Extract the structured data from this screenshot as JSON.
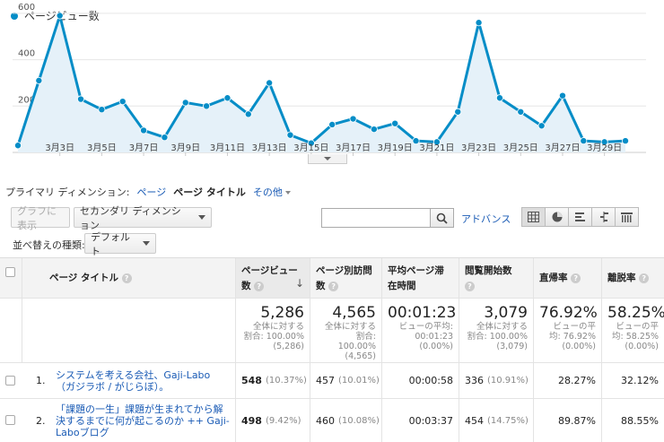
{
  "chart": {
    "legend": "ページビュー数",
    "color": "#058dc7"
  },
  "chart_data": {
    "type": "area",
    "series": [
      {
        "name": "ページビュー数",
        "values": [
          30,
          310,
          590,
          230,
          185,
          220,
          95,
          65,
          215,
          200,
          235,
          165,
          300,
          75,
          40,
          120,
          145,
          100,
          125,
          50,
          45,
          175,
          560,
          235,
          175,
          115,
          245,
          50,
          45,
          50
        ]
      }
    ],
    "x": [
      "3月1日",
      "3月2日",
      "3月3日",
      "3月4日",
      "3月5日",
      "3月6日",
      "3月7日",
      "3月8日",
      "3月9日",
      "3月10日",
      "3月11日",
      "3月12日",
      "3月13日",
      "3月14日",
      "3月15日",
      "3月16日",
      "3月17日",
      "3月18日",
      "3月19日",
      "3月20日",
      "3月21日",
      "3月22日",
      "3月23日",
      "3月24日",
      "3月25日",
      "3月26日",
      "3月27日",
      "3月28日",
      "3月29日",
      "3月30日"
    ],
    "x_tick_labels": [
      "3月3日",
      "3月5日",
      "3月7日",
      "3月9日",
      "3月11日",
      "3月13日",
      "3月15日",
      "3月17日",
      "3月19日",
      "3月21日",
      "3月23日",
      "3月25日",
      "3月27日",
      "3月29日"
    ],
    "y_tick_labels": [
      "200",
      "400",
      "600"
    ],
    "ylim": [
      0,
      650
    ],
    "grid": true
  },
  "dimension": {
    "label": "プライマリ ディメンション:",
    "options": [
      "ページ",
      "ページ タイトル",
      "その他"
    ]
  },
  "toolbar": {
    "graph_button": "グラフに表示",
    "secondary_dimension": "セカンダリ ディメンション",
    "search_value": "",
    "advanced": "アドバンス",
    "sort_label": "並べ替えの種類:",
    "sort_value": "デフォルト"
  },
  "table": {
    "headers": {
      "title": "ページ タイトル",
      "pageviews": "ページビュー数",
      "unique": "ページ別訪問数",
      "avg_time": "平均ページ滞在時間",
      "entrances": "閲覧開始数",
      "bounce": "直帰率",
      "exit": "離脱率"
    },
    "totals": {
      "pageviews": {
        "value": "5,286",
        "sub1": "全体に対する",
        "sub2": "割合: 100.00%",
        "sub3": "(5,286)"
      },
      "unique": {
        "value": "4,565",
        "sub1": "全体に対する",
        "sub2": "割合: 100.00%",
        "sub3": "(4,565)"
      },
      "avg_time": {
        "value": "00:01:23",
        "sub1": "ビューの平均:",
        "sub2": "00:01:23",
        "sub3": "(0.00%)"
      },
      "entrances": {
        "value": "3,079",
        "sub1": "全体に対する",
        "sub2": "割合: 100.00%",
        "sub3": "(3,079)"
      },
      "bounce": {
        "value": "76.92%",
        "sub1": "ビューの平",
        "sub2": "均: 76.92%",
        "sub3": "(0.00%)"
      },
      "exit": {
        "value": "58.25%",
        "sub1": "ビューの平",
        "sub2": "均: 58.25%",
        "sub3": "(0.00%)"
      }
    },
    "rows": [
      {
        "index": "1.",
        "title": "システムを考える会社、Gaji-Labo（ガジラボ / がじらぼ）。",
        "pageviews": "548",
        "pageviews_pct": "(10.37%)",
        "unique": "457",
        "unique_pct": "(10.01%)",
        "avg_time": "00:00:58",
        "entrances": "336",
        "entrances_pct": "(10.91%)",
        "bounce": "28.27%",
        "exit": "32.12%"
      },
      {
        "index": "2.",
        "title": "「課題の一生」課題が生まれてから解決するまでに何が起こるのか ++ Gaji-Laboブログ",
        "pageviews": "498",
        "pageviews_pct": "(9.42%)",
        "unique": "460",
        "unique_pct": "(10.08%)",
        "avg_time": "00:03:37",
        "entrances": "454",
        "entrances_pct": "(14.75%)",
        "bounce": "89.87%",
        "exit": "88.55%"
      }
    ]
  }
}
